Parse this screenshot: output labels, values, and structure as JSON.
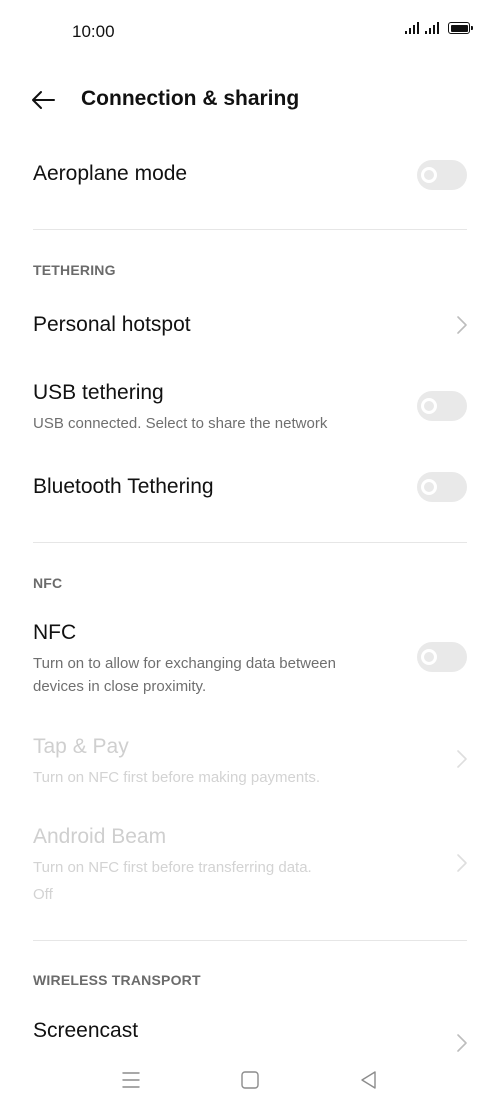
{
  "status_bar": {
    "time": "10:00",
    "icons": [
      "signal-icon",
      "signal-icon",
      "battery-icon"
    ]
  },
  "header": {
    "title": "Connection & sharing",
    "back_icon": "back-arrow-icon"
  },
  "airplane": {
    "title": "Aeroplane mode",
    "enabled": false
  },
  "tethering": {
    "header": "TETHERING",
    "items": [
      {
        "title": "Personal hotspot",
        "control": "chevron"
      },
      {
        "title": "USB tethering",
        "subtitle": "USB connected. Select to share the network",
        "control": "toggle",
        "enabled": false
      },
      {
        "title": "Bluetooth Tethering",
        "control": "toggle",
        "enabled": false
      }
    ]
  },
  "nfc": {
    "header": "NFC",
    "items": [
      {
        "title": "NFC",
        "subtitle_lines": [
          "Turn on to allow for exchanging data between",
          "devices in close proximity."
        ],
        "control": "toggle",
        "enabled": false
      },
      {
        "title": "Tap & Pay",
        "subtitle": "Turn on NFC first before making payments.",
        "control": "chevron",
        "disabled": true
      },
      {
        "title": "Android Beam",
        "subtitle_lines": [
          "Turn on NFC first before transferring data.",
          "Off"
        ],
        "control": "chevron",
        "disabled": true
      }
    ]
  },
  "wireless": {
    "header": "WIRELESS TRANSPORT",
    "items": [
      {
        "title": "Screencast",
        "control": "chevron"
      }
    ]
  },
  "nav_bar": {
    "buttons": [
      "menu-icon",
      "home-icon",
      "back-triangle-icon"
    ]
  },
  "colors": {
    "toggle_off": "#e9e9e9",
    "text_primary": "#111111",
    "text_secondary": "#6f6f6f",
    "text_disabled": "#cfcfcf",
    "divider": "#e6e6e6"
  }
}
